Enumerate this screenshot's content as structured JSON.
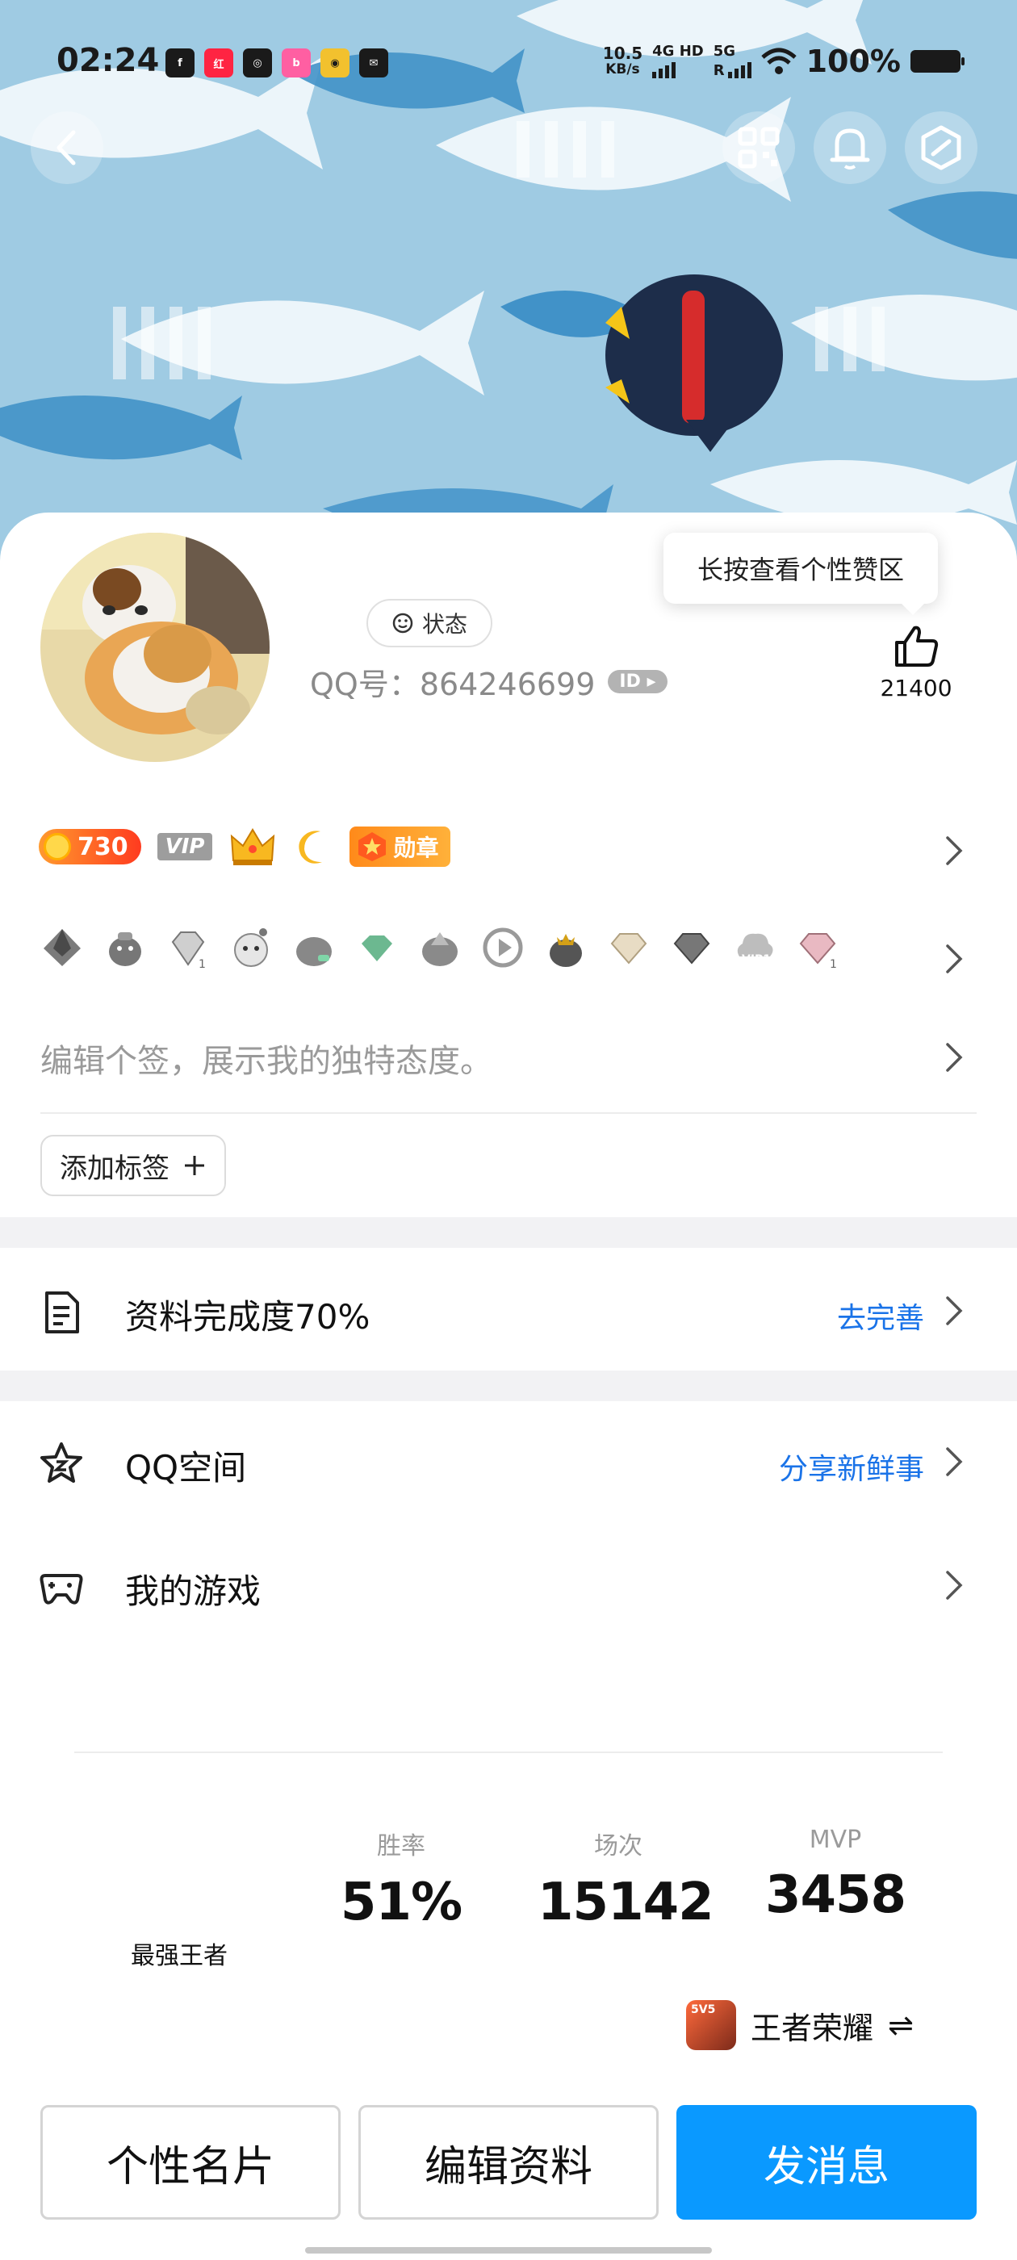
{
  "status_bar": {
    "time": "02:24",
    "notif_icons": [
      "facebook-icon",
      "xiaohongshu-icon",
      "instagram-icon",
      "bilibili-icon",
      "app-icon",
      "mail-icon"
    ],
    "speed_value": "10.5",
    "speed_unit": "KB/s",
    "net1": "4G HD",
    "net2": "5G",
    "roaming": "R",
    "battery": "100%"
  },
  "header": {
    "back_icon": "back-icon",
    "qr_icon": "qr-code-icon",
    "bell_icon": "bell-icon",
    "settings_icon": "settings-icon"
  },
  "profile": {
    "status_label": "状态",
    "qq_label": "QQ号：864246699",
    "id_badge": "ID",
    "tooltip": "长按查看个性赞区",
    "likes": "21400"
  },
  "badges": {
    "level": "730",
    "vip": "VIP",
    "medal": "勋章"
  },
  "signature": {
    "placeholder": "编辑个签，展示我的独特态度。"
  },
  "tags": {
    "add_label": "添加标签"
  },
  "completion": {
    "title": "资料完成度70%",
    "action": "去完善"
  },
  "qzone": {
    "title": "QQ空间",
    "action": "分享新鲜事"
  },
  "games": {
    "title": "我的游戏",
    "rank": "最强王者",
    "stats": [
      {
        "label": "胜率",
        "value": "51%"
      },
      {
        "label": "场次",
        "value": "15142"
      },
      {
        "label": "MVP",
        "value": "3458"
      }
    ],
    "game_name": "王者荣耀",
    "switch_symbol": "⇌",
    "thumb_text": "5V5"
  },
  "actions": {
    "card": "个性名片",
    "edit": "编辑资料",
    "message": "发消息"
  },
  "colors": {
    "accent": "#0a99ff",
    "link": "#1a73e8",
    "hero_bg": "#9fcbe3"
  }
}
